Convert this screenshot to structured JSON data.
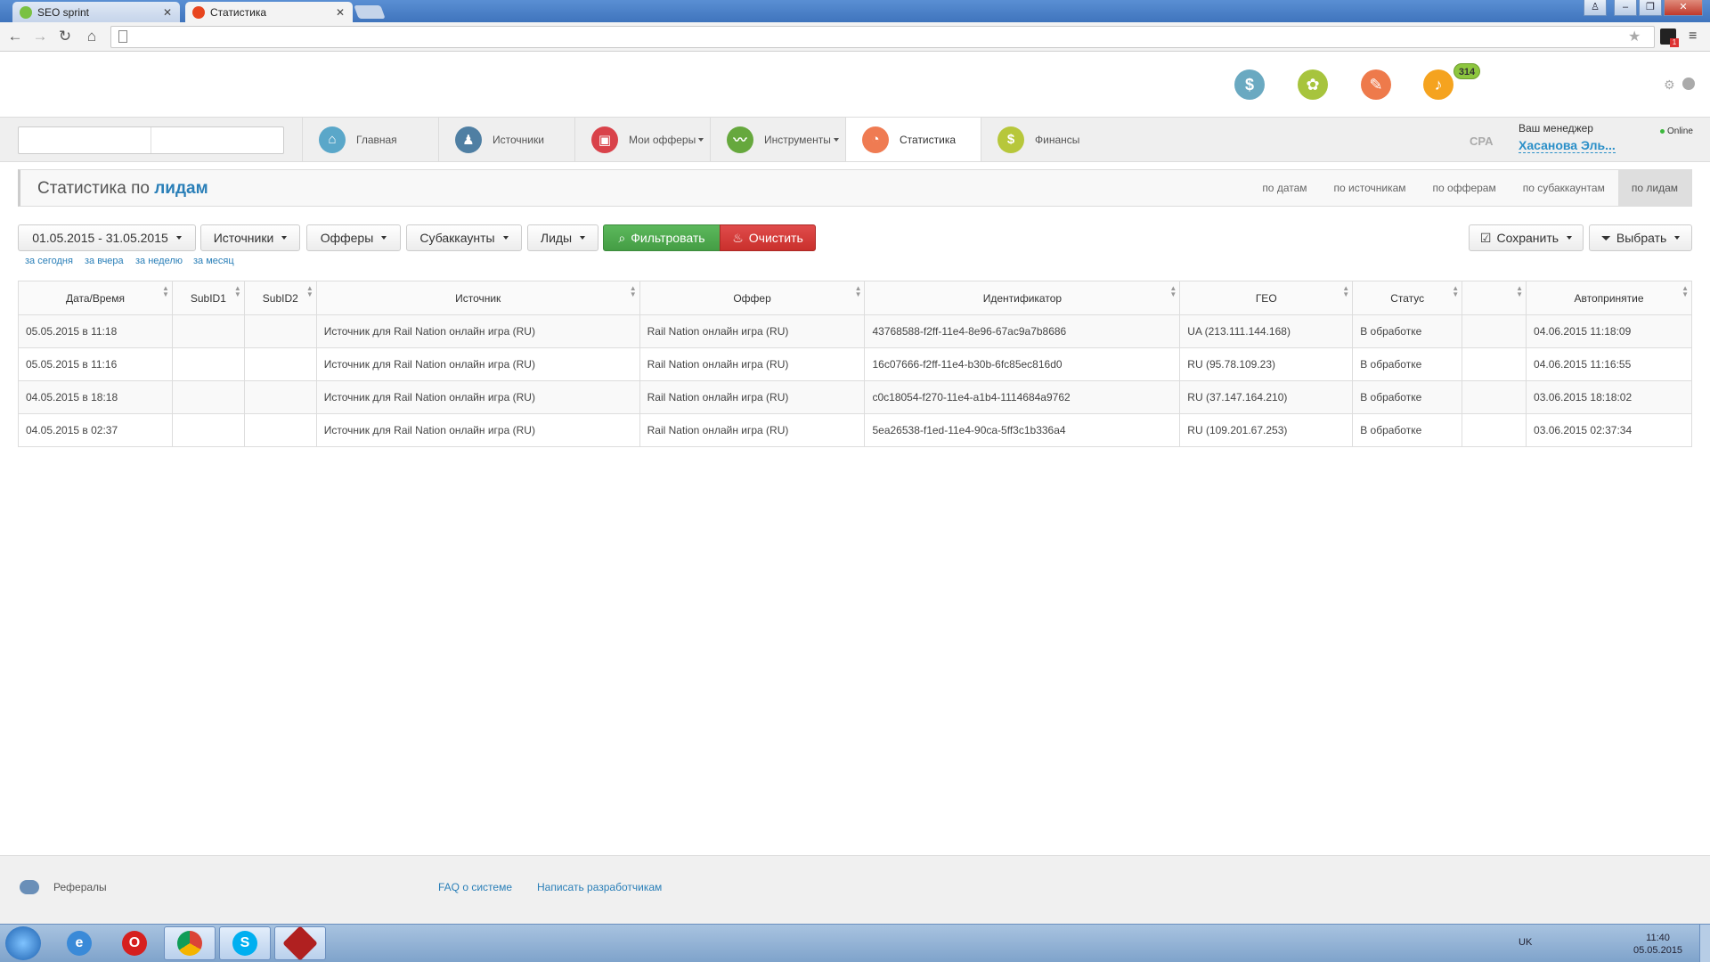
{
  "browser": {
    "tabs": [
      {
        "title": "SEO sprint",
        "active": false
      },
      {
        "title": "Статистика",
        "active": true
      }
    ]
  },
  "header": {
    "notifications_count": "314"
  },
  "nav": {
    "items": [
      {
        "label": "Главная",
        "icon": "home-icon",
        "color": "#5aa7c9",
        "glyph": "⌂",
        "caret": false
      },
      {
        "label": "Источники",
        "icon": "sources-icon",
        "color": "#4f7fa3",
        "glyph": "♟",
        "caret": false
      },
      {
        "label": "Мои офферы",
        "icon": "offers-icon",
        "color": "#d9424a",
        "glyph": "▣",
        "caret": true
      },
      {
        "label": "Инструменты",
        "icon": "tools-icon",
        "color": "#66a83d",
        "glyph": "〰",
        "caret": true
      },
      {
        "label": "Статистика",
        "icon": "statistics-icon",
        "color": "#ef7b52",
        "glyph": "◔",
        "caret": false,
        "active": true
      },
      {
        "label": "Финансы",
        "icon": "finance-icon",
        "color": "#b7c73b",
        "glyph": "$",
        "caret": false
      }
    ],
    "cpa_label": "CPA",
    "manager_label": "Ваш менеджер",
    "manager_name": "Хасанова Эль...",
    "status": "Online"
  },
  "page": {
    "title_prefix": "Статистика по",
    "title_highlight": "лидам",
    "subtabs": [
      {
        "label": "по датам",
        "active": false
      },
      {
        "label": "по источникам",
        "active": false
      },
      {
        "label": "по офферам",
        "active": false
      },
      {
        "label": "по субаккаунтам",
        "active": false
      },
      {
        "label": "по лидам",
        "active": true
      }
    ]
  },
  "filters": {
    "date_range": "01.05.2015 - 31.05.2015",
    "sources": "Источники",
    "offers": "Офферы",
    "subaccounts": "Субаккаунты",
    "leads": "Лиды",
    "filter": "Фильтровать",
    "clear": "Очистить",
    "save": "Сохранить",
    "select": "Выбрать",
    "quick": [
      "за сегодня",
      "за вчера",
      "за неделю",
      "за месяц"
    ]
  },
  "table": {
    "columns": [
      "Дата/Время",
      "SubID1",
      "SubID2",
      "Источник",
      "Оффер",
      "Идентификатор",
      "ГЕО",
      "Статус",
      "",
      "Автопринятие"
    ],
    "rows": [
      [
        "05.05.2015 в 11:18",
        "",
        "",
        "Источник для Rail Nation онлайн игра (RU)",
        "Rail Nation онлайн игра (RU)",
        "43768588-f2ff-11e4-8e96-67ac9a7b8686",
        "UA (213.111.144.168)",
        "В обработке",
        "",
        "04.06.2015 11:18:09"
      ],
      [
        "05.05.2015 в 11:16",
        "",
        "",
        "Источник для Rail Nation онлайн игра (RU)",
        "Rail Nation онлайн игра (RU)",
        "16c07666-f2ff-11e4-b30b-6fc85ec816d0",
        "RU (95.78.109.23)",
        "В обработке",
        "",
        "04.06.2015 11:16:55"
      ],
      [
        "04.05.2015 в 18:18",
        "",
        "",
        "Источник для Rail Nation онлайн игра (RU)",
        "Rail Nation онлайн игра (RU)",
        "c0c18054-f270-11e4-a1b4-1114684a9762",
        "RU (37.147.164.210)",
        "В обработке",
        "",
        "03.06.2015 18:18:02"
      ],
      [
        "04.05.2015 в 02:37",
        "",
        "",
        "Источник для Rail Nation онлайн игра (RU)",
        "Rail Nation онлайн игра (RU)",
        "5ea26538-f1ed-11e4-90ca-5ff3c1b336a4",
        "RU (109.201.67.253)",
        "В обработке",
        "",
        "03.06.2015 02:37:34"
      ]
    ]
  },
  "footer": {
    "referrals": "Рефералы",
    "faq": "FAQ о системе",
    "write_devs": "Написать разработчикам"
  },
  "taskbar": {
    "lang": "UK",
    "time": "11:40",
    "date": "05.05.2015"
  }
}
